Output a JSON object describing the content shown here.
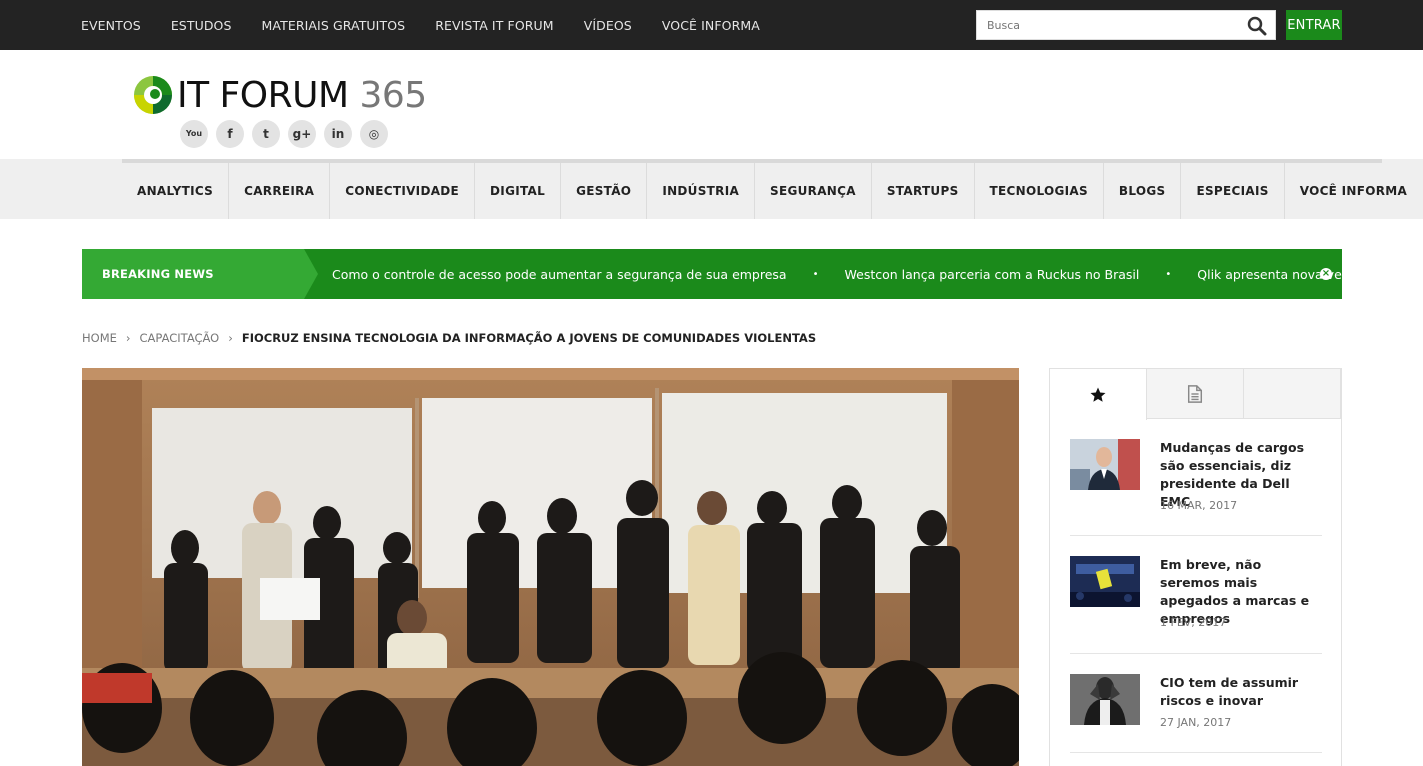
{
  "topnav": {
    "items": [
      "EVENTOS",
      "ESTUDOS",
      "MATERIAIS GRATUITOS",
      "REVISTA IT FORUM",
      "VÍDEOS",
      "VOCÊ INFORMA"
    ],
    "search_placeholder": "Busca",
    "login_label": "ENTRAR"
  },
  "logo": {
    "text": "IT FORUM",
    "number": "365"
  },
  "socials": [
    {
      "icon": "youtube-icon",
      "glyph": "You"
    },
    {
      "icon": "facebook-icon",
      "glyph": "f"
    },
    {
      "icon": "twitter-icon",
      "glyph": "t"
    },
    {
      "icon": "google-plus-icon",
      "glyph": "g+"
    },
    {
      "icon": "linkedin-icon",
      "glyph": "in"
    },
    {
      "icon": "instagram-icon",
      "glyph": "◎"
    }
  ],
  "categories": [
    "ANALYTICS",
    "CARREIRA",
    "CONECTIVIDADE",
    "DIGITAL",
    "GESTÃO",
    "INDÚSTRIA",
    "SEGURANÇA",
    "STARTUPS",
    "TECNOLOGIAS",
    "BLOGS",
    "ESPECIAIS",
    "VOCÊ INFORMA"
  ],
  "breaking": {
    "label": "BREAKING NEWS",
    "items": [
      "Como o controle de acesso pode aumentar a segurança de sua empresa",
      "Westcon lança parceria com a Ruckus no Brasil",
      "Qlik apresenta nova versão do Qlik Sense"
    ],
    "separator": "•",
    "close_glyph": "×"
  },
  "breadcrumb": {
    "home": "HOME",
    "section": "CAPACITAÇÃO",
    "separator": "›",
    "current": "FIOCRUZ ENSINA TECNOLOGIA DA INFORMAÇÃO A JOVENS DE COMUNIDADES VIOLENTAS"
  },
  "sidebar": {
    "tabs": [
      {
        "icon": "star-icon"
      },
      {
        "icon": "document-icon"
      },
      {
        "icon": ""
      }
    ],
    "posts": [
      {
        "title": "Mudanças de cargos são essenciais, diz presidente da Dell EMC",
        "date": "16 MAR, 2017"
      },
      {
        "title": "Em breve, não seremos mais apegados a marcas e empregos",
        "date": "1 FEV, 2017"
      },
      {
        "title": "CIO tem de assumir riscos e inovar",
        "date": "27 JAN, 2017"
      }
    ]
  },
  "colors": {
    "topbar": "#232323",
    "brand_green": "#1b8a1b",
    "breaking_label": "#34a934"
  }
}
